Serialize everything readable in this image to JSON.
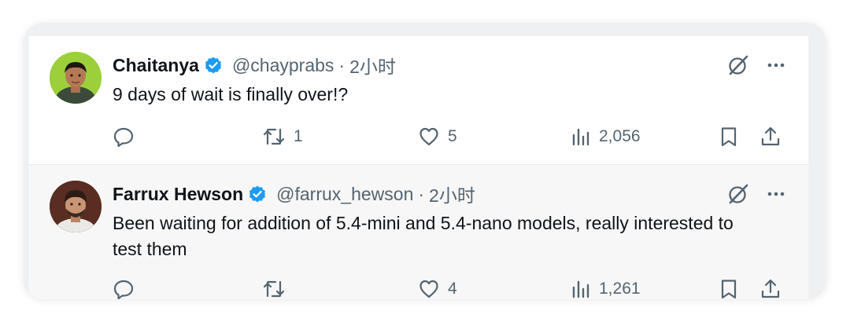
{
  "tweets": [
    {
      "name": "Chaitanya",
      "handle": "@chayprabs",
      "separator": "·",
      "time": "2小时",
      "text": "9 days of wait is finally over!?",
      "replies": "",
      "retweets": "1",
      "likes": "5",
      "views": "2,056"
    },
    {
      "name": "Farrux Hewson",
      "handle": "@farrux_hewson",
      "separator": "·",
      "time": "2小时",
      "text": "Been waiting for addition of 5.4-mini and 5.4-nano models, really interested to test them",
      "replies": "",
      "retweets": "",
      "likes": "4",
      "views": "1,261"
    }
  ],
  "icons": {
    "verified": "verified-badge-icon",
    "grok": "grok-icon",
    "more": "more-icon",
    "reply": "reply-icon",
    "retweet": "retweet-icon",
    "like": "heart-icon",
    "views": "views-icon",
    "bookmark": "bookmark-icon",
    "share": "share-icon"
  },
  "colors": {
    "verified": "#1d9bf0",
    "text": "#0f1419",
    "secondary": "#536471"
  }
}
